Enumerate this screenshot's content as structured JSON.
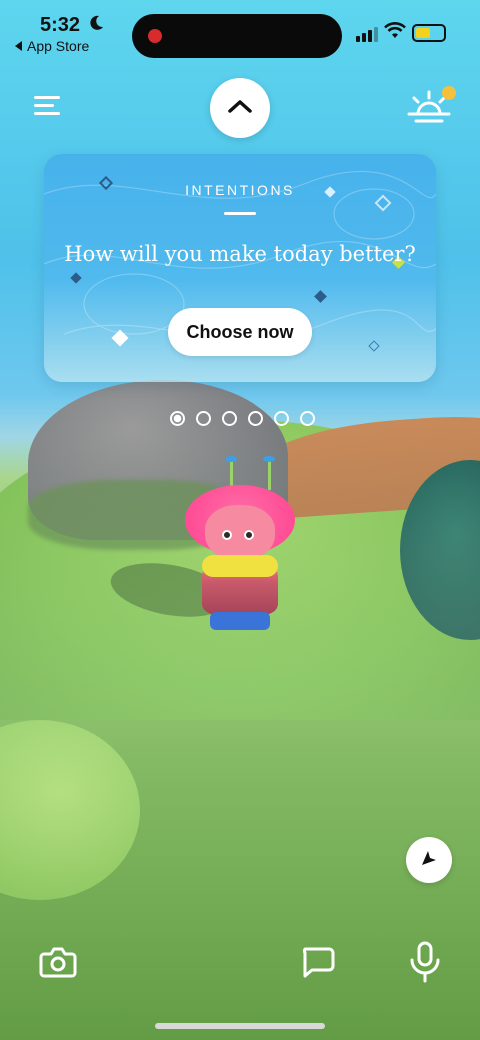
{
  "status_bar": {
    "time": "5:32",
    "back_app": "App Store",
    "battery_color": "#f2d21c"
  },
  "top_bar": {
    "menu_icon": "menu-icon",
    "expand_icon": "chevron-up-icon",
    "sunrise_icon": "sunrise-icon",
    "notification_color": "#f3c13b"
  },
  "intention_card": {
    "label": "INTENTIONS",
    "question": "How will you make today better?",
    "button_label": "Choose now"
  },
  "pagination": {
    "total": 6,
    "active_index": 0
  },
  "bottom_bar": {
    "camera_icon": "camera-icon",
    "chat_icon": "chat-bubble-icon",
    "mic_icon": "microphone-icon",
    "navigate_icon": "navigation-arrow-icon"
  },
  "colors": {
    "sky": "#4fc1ea",
    "grass": "#8ec060",
    "character_hair": "#ff4c95",
    "accent_white": "#ffffff"
  }
}
